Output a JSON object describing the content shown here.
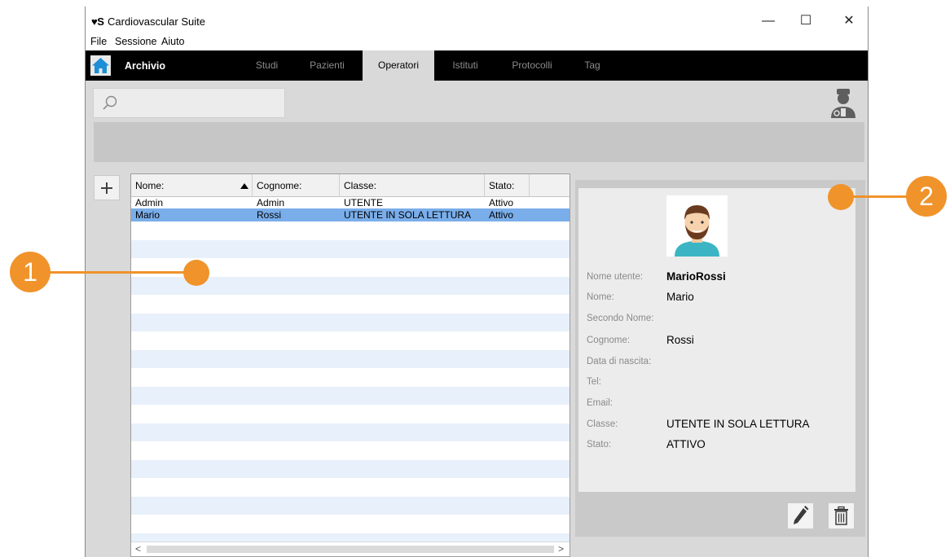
{
  "app": {
    "logo_text": "♥S",
    "title": "Cardiovascular Suite",
    "controls": {
      "minimize": "—",
      "maximize": "☐",
      "close": "✕"
    }
  },
  "menu": [
    "File",
    "Sessione",
    "Aiuto"
  ],
  "nav": {
    "home_label": "Archivio",
    "tabs": [
      {
        "label": "Studi",
        "active": false
      },
      {
        "label": "Pazienti",
        "active": false
      },
      {
        "label": "Operatori",
        "active": true
      },
      {
        "label": "Istituti",
        "active": false
      },
      {
        "label": "Protocolli",
        "active": false
      },
      {
        "label": "Tag",
        "active": false
      }
    ]
  },
  "search": {
    "value": "",
    "placeholder": ""
  },
  "table": {
    "columns": [
      "Nome:",
      "Cognome:",
      "Classe:",
      "Stato:"
    ],
    "sort_column": "Nome:",
    "sort_direction": "ascending",
    "rows": [
      {
        "nome": "Admin",
        "cognome": "Admin",
        "classe": "UTENTE",
        "stato": "Attivo",
        "selected": false
      },
      {
        "nome": "Mario",
        "cognome": "Rossi",
        "classe": "UTENTE IN SOLA LETTURA",
        "stato": "Attivo",
        "selected": true
      }
    ],
    "scroll_left": "<",
    "scroll_right": ">"
  },
  "detail": {
    "fields": [
      {
        "label": "Nome utente:",
        "value": "MarioRossi",
        "bold": true
      },
      {
        "label": "Nome:",
        "value": "Mario",
        "bold": false
      },
      {
        "label": "Secondo Nome:",
        "value": "",
        "bold": false
      },
      {
        "label": "Cognome:",
        "value": "Rossi",
        "bold": false
      },
      {
        "label": "Data di nascita:",
        "value": "",
        "bold": false
      },
      {
        "label": "Tel:",
        "value": "",
        "bold": false
      },
      {
        "label": "Email:",
        "value": "",
        "bold": false
      },
      {
        "label": "Classe:",
        "value": "UTENTE IN SOLA LETTURA",
        "bold": false
      },
      {
        "label": "Stato:",
        "value": "ATTIVO",
        "bold": false
      }
    ]
  },
  "callouts": [
    {
      "number": "1"
    },
    {
      "number": "2"
    }
  ],
  "colors": {
    "accent_callout": "#f0932b",
    "selected_row": "#7aaeea",
    "stripe_row": "#e8f0fb",
    "navbar": "#000000",
    "home_icon": "#1e8fd6"
  },
  "icons": {
    "app_logo": "heart-logo-icon",
    "home": "home-icon",
    "search": "search-icon",
    "user": "doctor-user-icon",
    "add": "plus-icon",
    "avatar": "user-avatar-icon",
    "edit": "pencil-icon",
    "delete": "trash-icon"
  }
}
